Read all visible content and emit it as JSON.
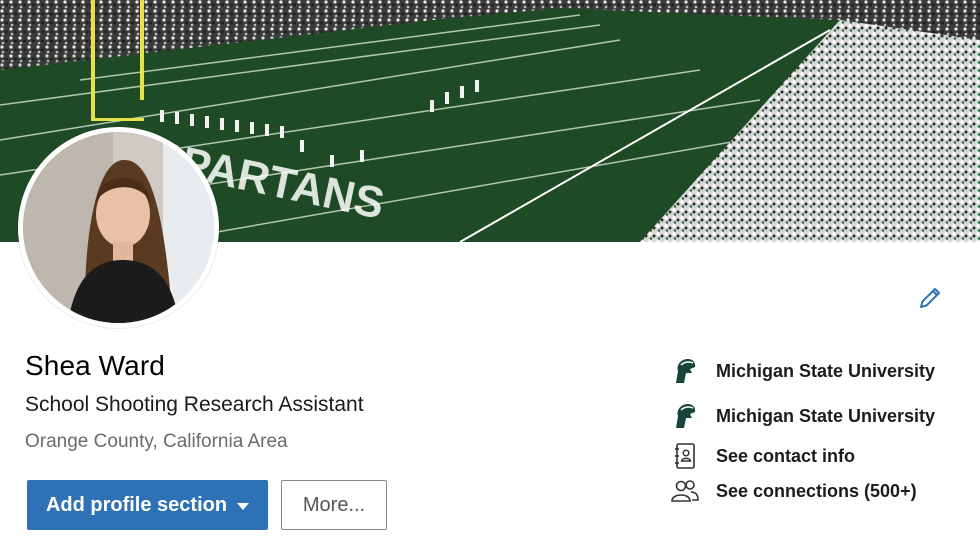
{
  "profile": {
    "name": "Shea Ward",
    "headline": "School Shooting Research Assistant",
    "location": "Orange County, California Area"
  },
  "actions": {
    "add_section_label": "Add profile section",
    "more_label": "More..."
  },
  "sidebar": {
    "items": [
      {
        "label": "Michigan State University",
        "icon": "spartan-logo-icon"
      },
      {
        "label": "Michigan State University",
        "icon": "spartan-logo-icon"
      },
      {
        "label": "See contact info",
        "icon": "contact-card-icon"
      },
      {
        "label": "See connections (500+)",
        "icon": "people-icon"
      }
    ]
  },
  "banner": {
    "field_text": "SPARTANS"
  },
  "colors": {
    "primary_button": "#2f71b5",
    "edit_icon": "#2f71b5",
    "spartan_green": "#18453b",
    "field_green": "#1f4a26"
  }
}
